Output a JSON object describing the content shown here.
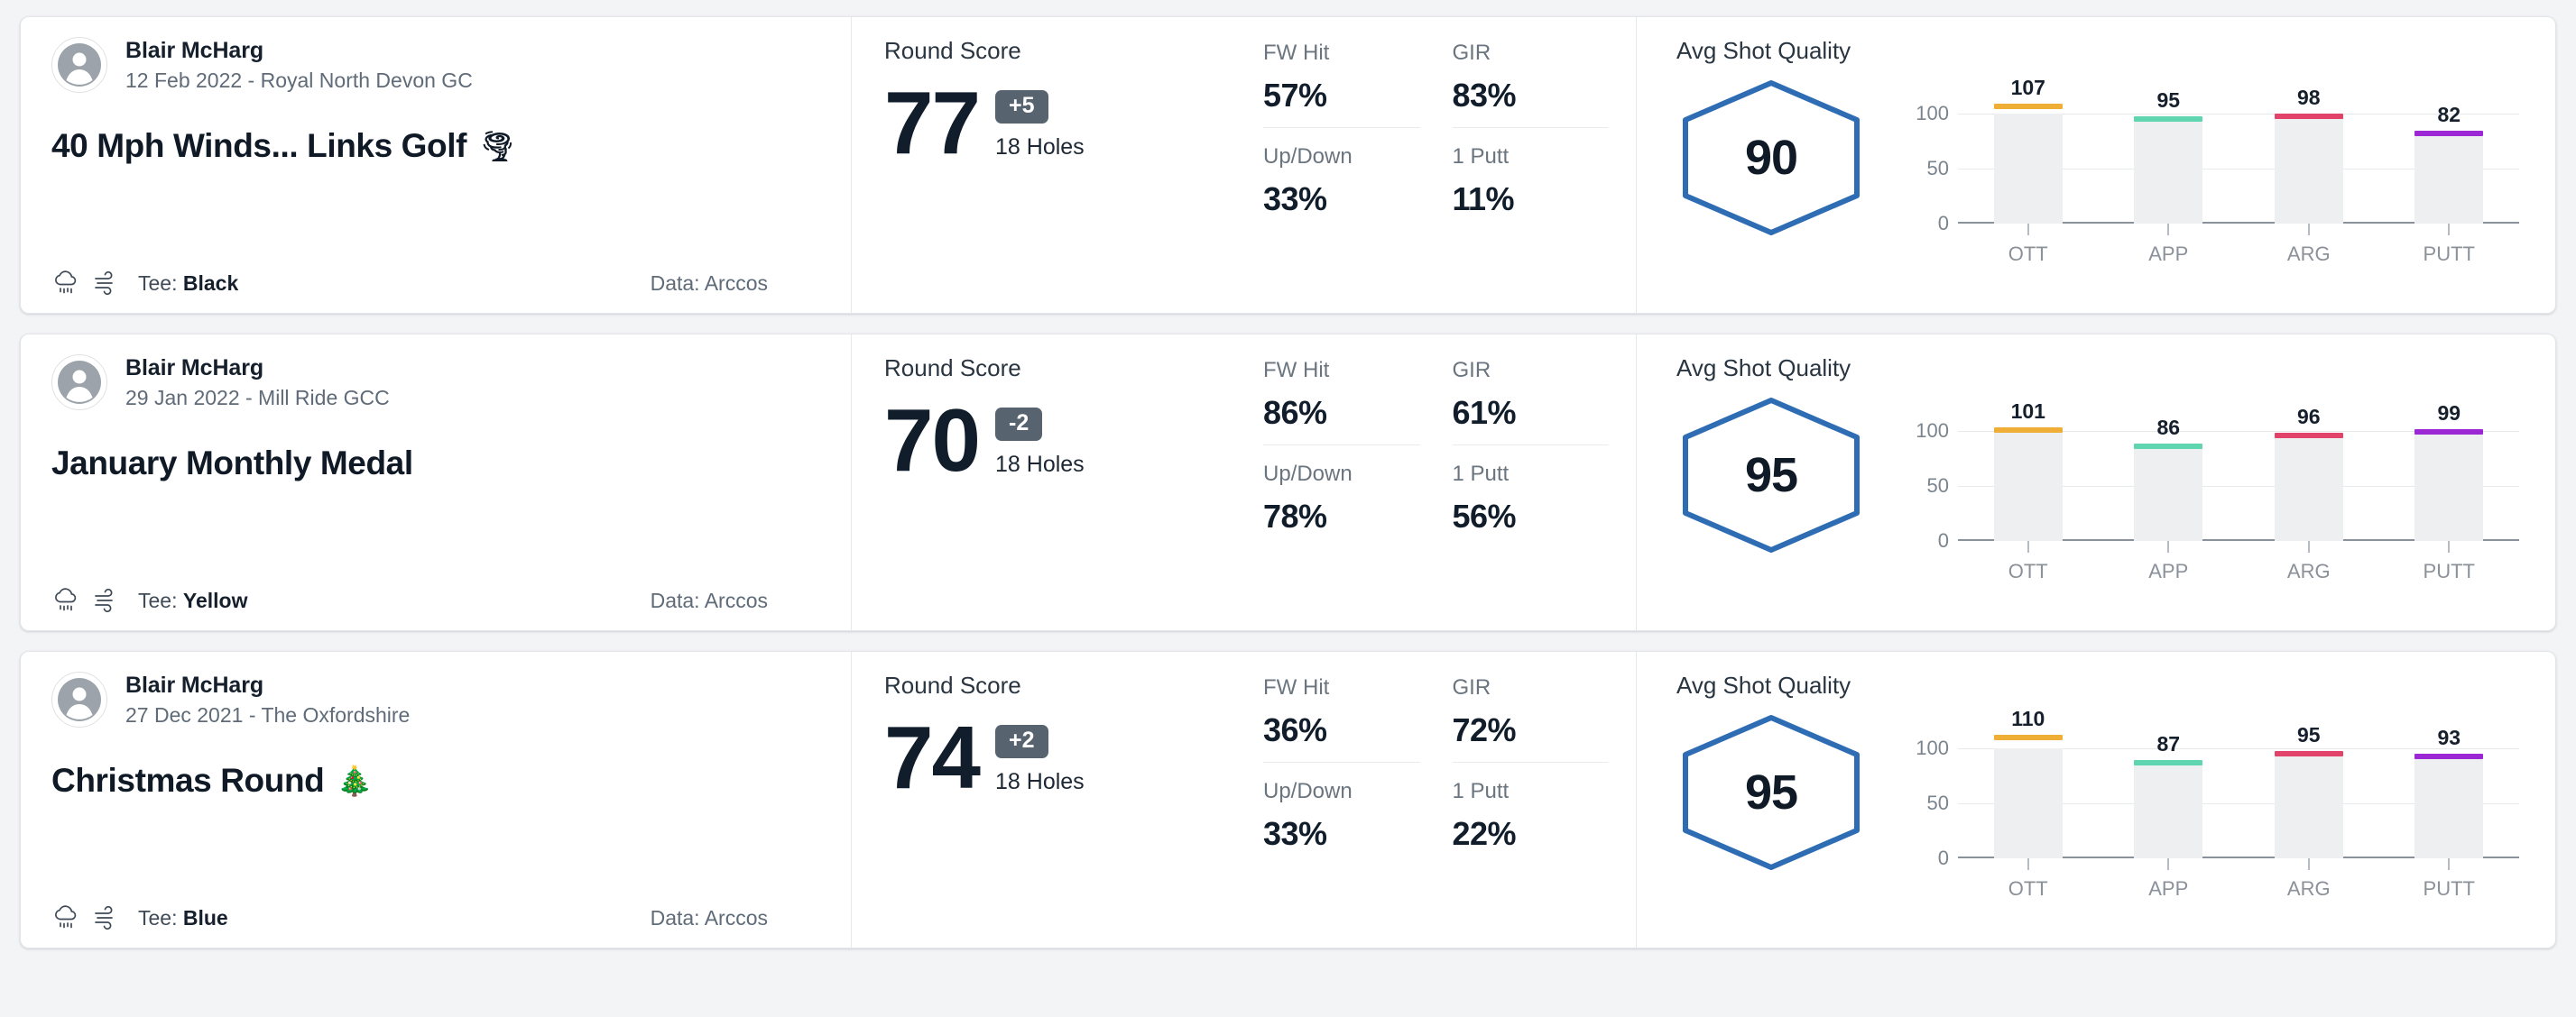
{
  "labels": {
    "round_score": "Round Score",
    "holes": "18 Holes",
    "fw_hit": "FW Hit",
    "gir": "GIR",
    "up_down": "Up/Down",
    "one_putt": "1 Putt",
    "avg_shot_quality": "Avg Shot Quality",
    "tee_prefix": "Tee:",
    "data_prefix": "Data:",
    "weather_icons": [
      "rain-cloud-icon",
      "wind-icon"
    ],
    "avatar_icon": "user-avatar-icon"
  },
  "colors": {
    "hexagon_stroke": "#2E6DB4",
    "score_badge_bg": "#57636F",
    "bar_track": "#EEEFF0",
    "ott": "#EFAF36",
    "app": "#5FD6B0",
    "arg": "#E2436A",
    "putt": "#9C27D4",
    "page_bg": "#F3F4F6",
    "card_bg": "#FFFFFF"
  },
  "chart_axis": {
    "y_ticks": [
      "100",
      "50",
      "0"
    ],
    "y_values": [
      100,
      50,
      0
    ],
    "ymin": 0,
    "ymax": 115,
    "categories": [
      "OTT",
      "APP",
      "ARG",
      "PUTT"
    ]
  },
  "rounds": [
    {
      "player": "Blair McHarg",
      "date_course": "12 Feb 2022 - Royal North Devon GC",
      "title": "40 Mph Winds... Links Golf",
      "title_emoji": "🌪",
      "tee": "Black",
      "data_source": "Arccos",
      "score": "77",
      "diff": "+5",
      "holes": "18 Holes",
      "stats": {
        "fw_hit": "57%",
        "gir": "83%",
        "up_down": "33%",
        "one_putt": "11%"
      },
      "shot_quality": "90",
      "chart_data": {
        "type": "bar",
        "title": "Avg Shot Quality",
        "categories": [
          "OTT",
          "APP",
          "ARG",
          "PUTT"
        ],
        "values": [
          107,
          95,
          98,
          82
        ],
        "ylim": [
          0,
          115
        ],
        "yticks": [
          0,
          50,
          100
        ],
        "grid": true,
        "legend": "none"
      }
    },
    {
      "player": "Blair McHarg",
      "date_course": "29 Jan 2022 - Mill Ride GCC",
      "title": "January Monthly Medal",
      "title_emoji": "",
      "tee": "Yellow",
      "data_source": "Arccos",
      "score": "70",
      "diff": "-2",
      "holes": "18 Holes",
      "stats": {
        "fw_hit": "86%",
        "gir": "61%",
        "up_down": "78%",
        "one_putt": "56%"
      },
      "shot_quality": "95",
      "chart_data": {
        "type": "bar",
        "title": "Avg Shot Quality",
        "categories": [
          "OTT",
          "APP",
          "ARG",
          "PUTT"
        ],
        "values": [
          101,
          86,
          96,
          99
        ],
        "ylim": [
          0,
          115
        ],
        "yticks": [
          0,
          50,
          100
        ],
        "grid": true,
        "legend": "none"
      }
    },
    {
      "player": "Blair McHarg",
      "date_course": "27 Dec 2021 - The Oxfordshire",
      "title": "Christmas Round",
      "title_emoji": "🎄",
      "tee": "Blue",
      "data_source": "Arccos",
      "score": "74",
      "diff": "+2",
      "holes": "18 Holes",
      "stats": {
        "fw_hit": "36%",
        "gir": "72%",
        "up_down": "33%",
        "one_putt": "22%"
      },
      "shot_quality": "95",
      "chart_data": {
        "type": "bar",
        "title": "Avg Shot Quality",
        "categories": [
          "OTT",
          "APP",
          "ARG",
          "PUTT"
        ],
        "values": [
          110,
          87,
          95,
          93
        ],
        "ylim": [
          0,
          115
        ],
        "yticks": [
          0,
          50,
          100
        ],
        "grid": true,
        "legend": "none"
      }
    }
  ]
}
